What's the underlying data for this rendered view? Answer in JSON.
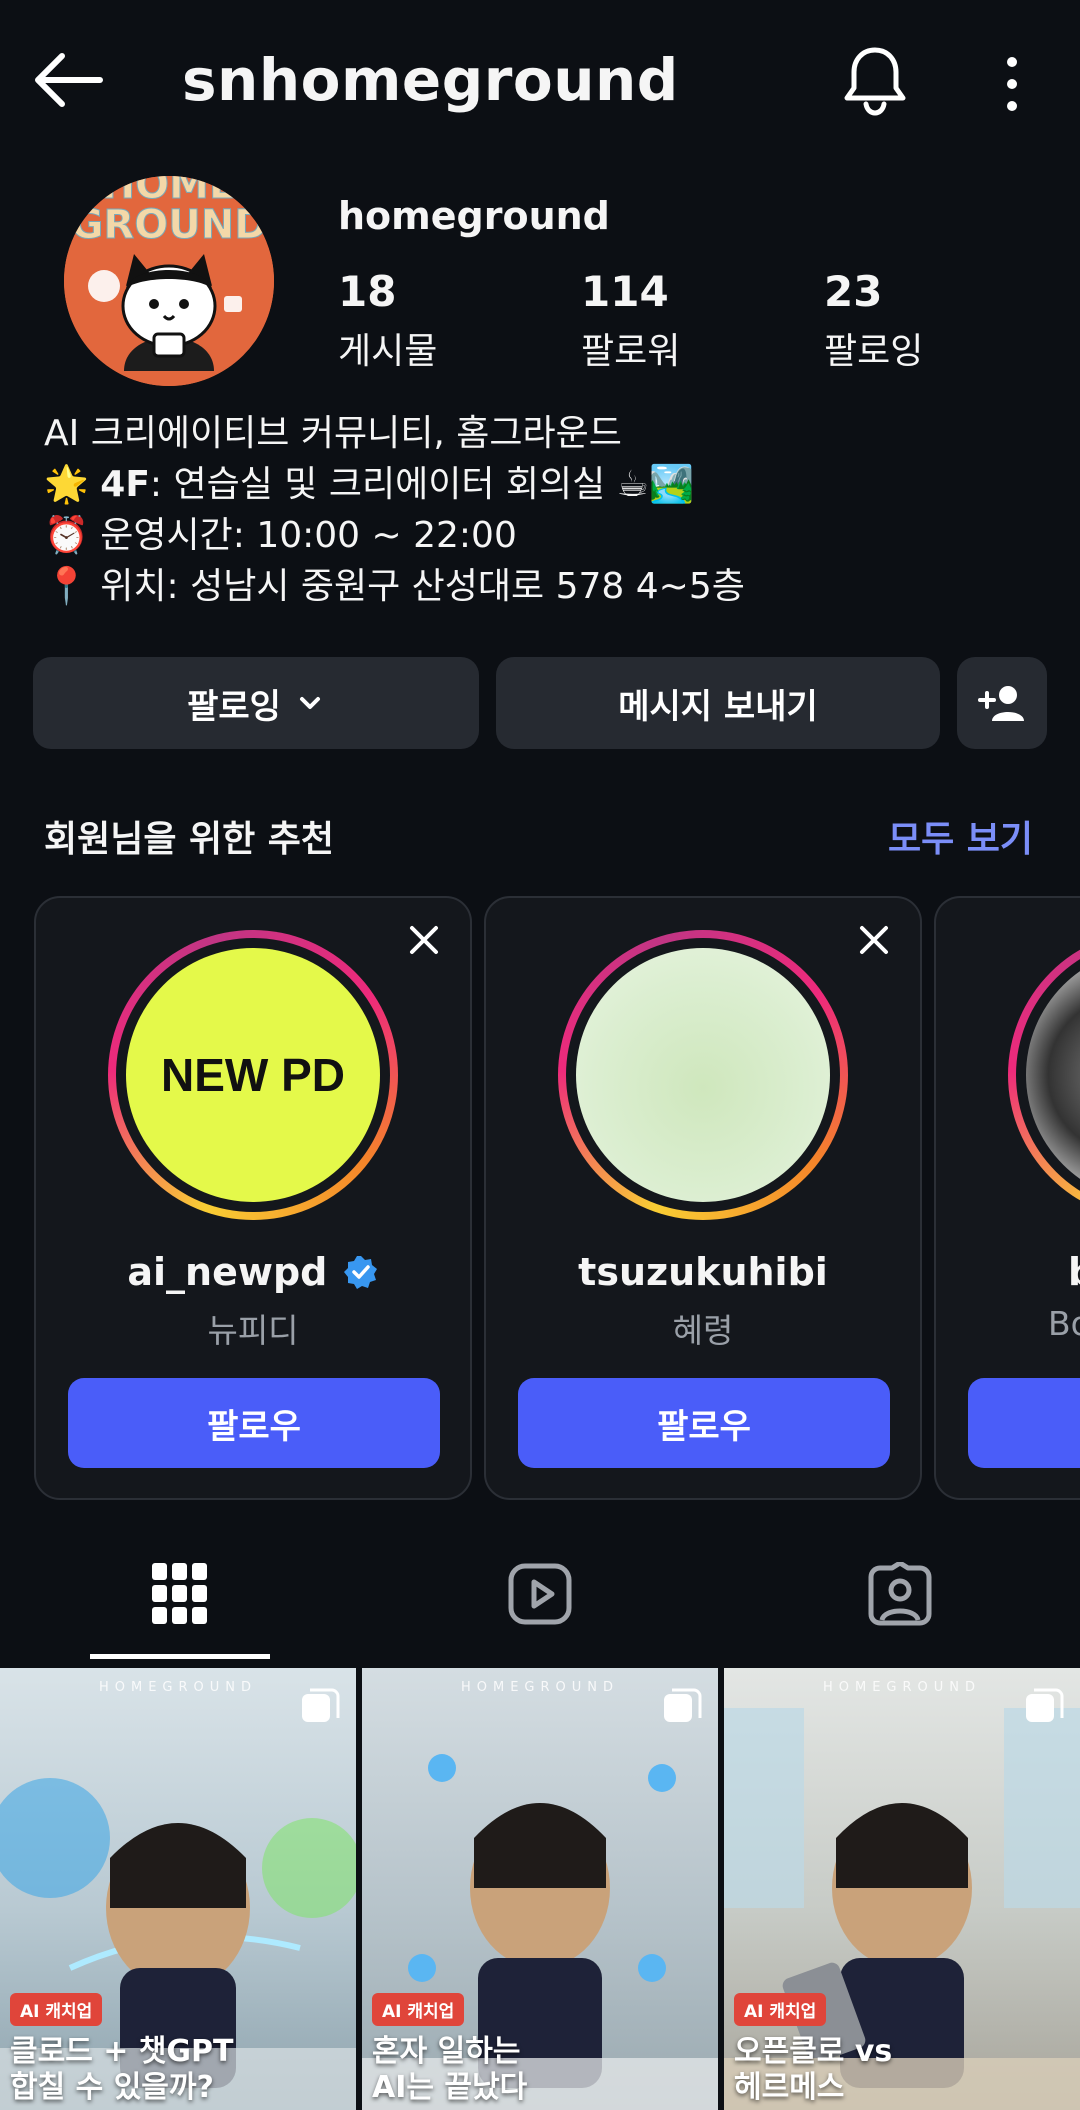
{
  "header": {
    "title": "snhomeground"
  },
  "profile": {
    "name": "homeground",
    "stats": [
      {
        "value": "18",
        "label": "게시물"
      },
      {
        "value": "114",
        "label": "팔로워"
      },
      {
        "value": "23",
        "label": "팔로잉"
      }
    ],
    "bio": {
      "line1": "AI 크리에이티브 커뮤니티, 홈그라운드",
      "line2_emoji": "🌟",
      "line2_bold": "4F",
      "line2_text": ": 연습실 및 크리에이터 회의실 ☕🏞️",
      "line3": "⏰ 운영시간: 10:00 ~ 22:00",
      "line4": "📍 위치: 성남시 중원구 산성대로 578 4~5층"
    }
  },
  "actions": {
    "following_label": "팔로잉",
    "message_label": "메시지 보내기"
  },
  "suggestions": {
    "title": "회원님을 위한 추천",
    "see_all": "모두 보기",
    "cards": [
      {
        "username": "ai_newpd",
        "display_name": "뉴피디",
        "follow_label": "팔로우",
        "avatar_text": "NEW PD",
        "verified": true
      },
      {
        "username": "tsuzukuhibi",
        "display_name": "혜령",
        "follow_label": "팔로우",
        "verified": false
      },
      {
        "username": "b",
        "display_name": "Bo",
        "follow_label": "팔로우",
        "verified": false
      }
    ]
  },
  "tabs": [
    "grid-icon",
    "reels-icon",
    "tagged-icon"
  ],
  "posts": [
    {
      "brand": "HOMEGROUND",
      "tag": "AI 캐치업",
      "caption_line1": "클로드 + 챗GPT",
      "caption_line2": "합칠 수 있을까?"
    },
    {
      "brand": "HOMEGROUND",
      "tag": "AI 캐치업",
      "caption_line1": "혼자 일하는",
      "caption_line2": "AI는 끝났다"
    },
    {
      "brand": "HOMEGROUND",
      "tag": "AI 캐치업",
      "caption_line1": "오픈클로 vs",
      "caption_line2": "헤르메스"
    }
  ],
  "colors": {
    "background": "#0c0f14",
    "button": "#262a31",
    "accent_blue": "#4a5df9",
    "link_blue": "#7b8ef8",
    "verified": "#3897f0",
    "tag_red": "#e0453a"
  }
}
